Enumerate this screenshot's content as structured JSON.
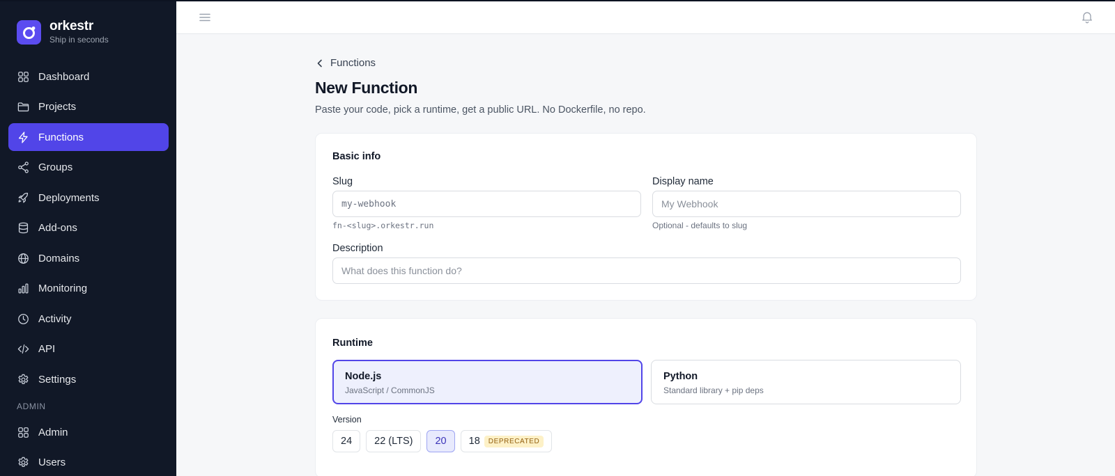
{
  "brand": {
    "name": "orkestr",
    "tagline": "Ship in seconds"
  },
  "sidebar": {
    "items": [
      {
        "label": "Dashboard",
        "icon": "grid-icon"
      },
      {
        "label": "Projects",
        "icon": "folder-icon"
      },
      {
        "label": "Functions",
        "icon": "bolt-icon",
        "active": true
      },
      {
        "label": "Groups",
        "icon": "share-icon"
      },
      {
        "label": "Deployments",
        "icon": "rocket-icon"
      },
      {
        "label": "Add-ons",
        "icon": "database-icon"
      },
      {
        "label": "Domains",
        "icon": "globe-icon"
      },
      {
        "label": "Monitoring",
        "icon": "bar-chart-icon"
      },
      {
        "label": "Activity",
        "icon": "clock-icon"
      },
      {
        "label": "API",
        "icon": "code-icon"
      },
      {
        "label": "Settings",
        "icon": "gear-icon"
      }
    ],
    "admin_section": "ADMIN",
    "admin_items": [
      {
        "label": "Admin",
        "icon": "grid-icon"
      },
      {
        "label": "Users",
        "icon": "gear-icon"
      }
    ]
  },
  "topbar": {
    "menu_icon": "menu-icon",
    "bell_icon": "bell-icon"
  },
  "breadcrumb": {
    "label": "Functions"
  },
  "page": {
    "title": "New Function",
    "subtitle": "Paste your code, pick a runtime, get a public URL. No Dockerfile, no repo."
  },
  "basic_info": {
    "title": "Basic info",
    "slug_label": "Slug",
    "slug_placeholder": "my-webhook",
    "slug_hint": "fn-<slug>.orkestr.run",
    "display_name_label": "Display name",
    "display_name_placeholder": "My Webhook",
    "display_name_hint": "Optional - defaults to slug",
    "description_label": "Description",
    "description_placeholder": "What does this function do?"
  },
  "runtime": {
    "title": "Runtime",
    "options": [
      {
        "name": "Node.js",
        "desc": "JavaScript / CommonJS",
        "selected": true
      },
      {
        "name": "Python",
        "desc": "Standard library + pip deps",
        "selected": false
      }
    ],
    "version_label": "Version",
    "versions": [
      {
        "label": "24",
        "selected": false
      },
      {
        "label": "22 (LTS)",
        "selected": false
      },
      {
        "label": "20",
        "selected": true
      },
      {
        "label": "18",
        "selected": false,
        "badge": "DEPRECATED"
      }
    ]
  },
  "colors": {
    "accent": "#5145e8",
    "sidebar_bg": "#111827",
    "logo_bg": "#5b4cf0"
  }
}
